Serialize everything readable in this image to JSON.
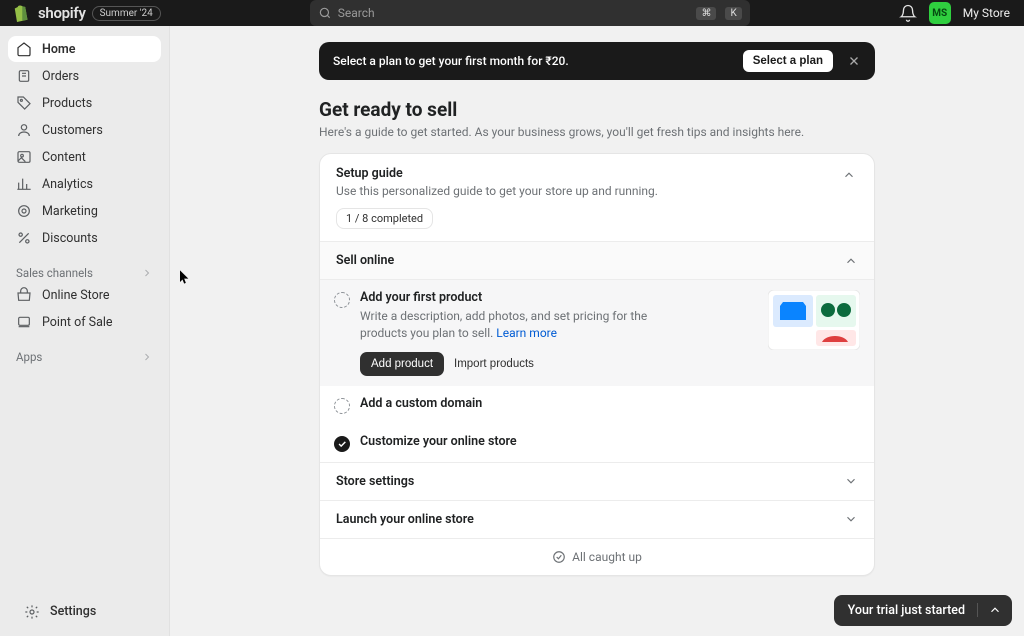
{
  "topbar": {
    "brand": "shopify",
    "season": "Summer '24",
    "search_placeholder": "Search",
    "kbd1": "⌘",
    "kbd2": "K",
    "store_initials": "MS",
    "store_name": "My Store"
  },
  "sidebar": {
    "nav": [
      "Home",
      "Orders",
      "Products",
      "Customers",
      "Content",
      "Analytics",
      "Marketing",
      "Discounts"
    ],
    "sales_channels_label": "Sales channels",
    "channels": [
      "Online Store",
      "Point of Sale"
    ],
    "apps_label": "Apps",
    "settings_label": "Settings"
  },
  "banner": {
    "message": "Select a plan to get your first month for ₹20.",
    "cta": "Select a plan"
  },
  "page": {
    "title": "Get ready to sell",
    "subtitle": "Here's a guide to get started. As your business grows, you'll get fresh tips and insights here."
  },
  "guide": {
    "title": "Setup guide",
    "subtitle": "Use this personalized guide to get your store up and running.",
    "progress": "1 / 8 completed",
    "sections": {
      "sell_online": "Sell online",
      "store_settings": "Store settings",
      "launch": "Launch your online store"
    },
    "task1": {
      "title": "Add your first product",
      "desc": "Write a description, add photos, and set pricing for the products you plan to sell. ",
      "learn_more": "Learn more",
      "cta_primary": "Add product",
      "cta_secondary": "Import products"
    },
    "task2": {
      "title": "Add a custom domain"
    },
    "task3": {
      "title": "Customize your online store"
    },
    "caught_up": "All caught up"
  },
  "trial": {
    "label": "Your trial just started"
  }
}
